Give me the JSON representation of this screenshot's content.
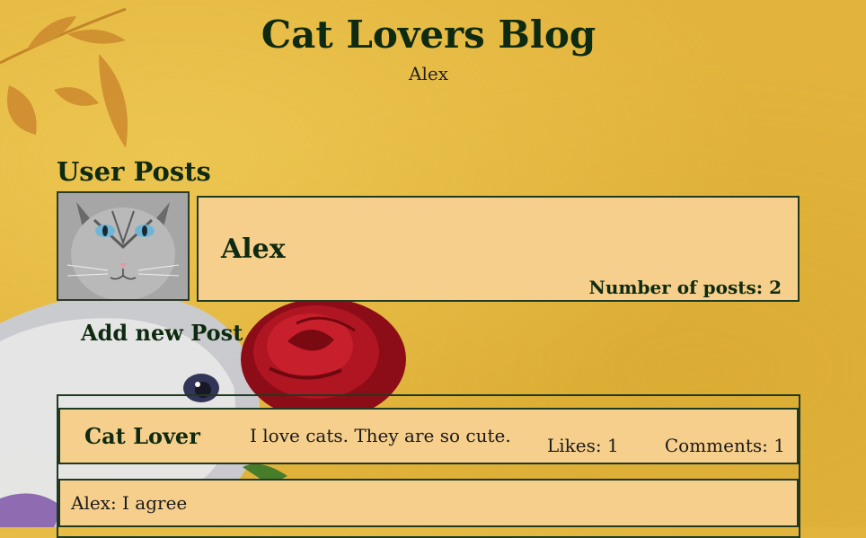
{
  "header": {
    "title": "Cat Lovers Blog",
    "subtitle": "Alex"
  },
  "section": {
    "title": "User Posts"
  },
  "user": {
    "name": "Alex",
    "post_count_text": "Number of posts: 2",
    "avatar_icon": "cat-avatar-icon"
  },
  "actions": {
    "add_post_label": "Add new Post"
  },
  "posts": [
    {
      "author": "Cat Lover",
      "text": "I love cats. They are so cute.",
      "likes": "Likes: 1",
      "comments": "Comments: 1",
      "comment_list": [
        {
          "text": "Alex: I agree"
        }
      ]
    }
  ],
  "colors": {
    "background": "#e2b43c",
    "card": "#f6cf8c",
    "border": "#1f3a22",
    "heading": "#0e2a10"
  }
}
